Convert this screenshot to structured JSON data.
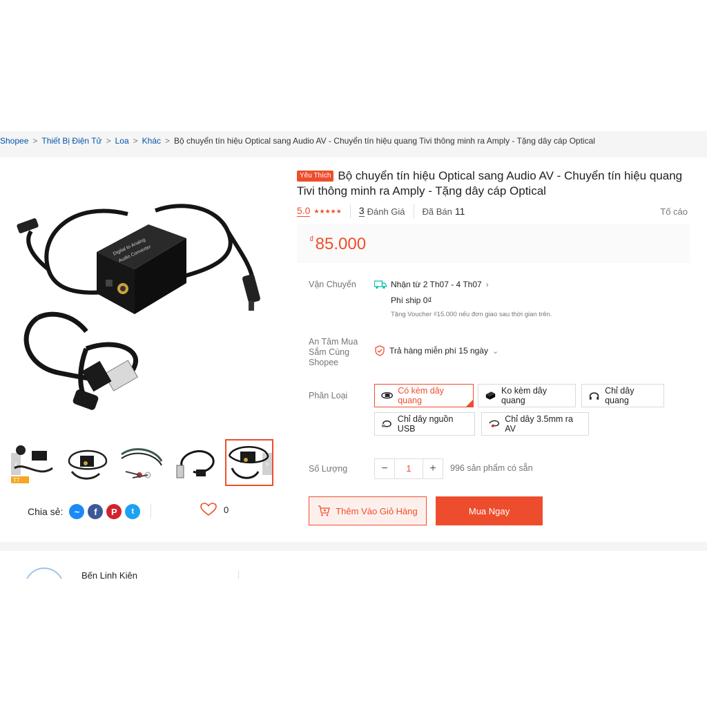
{
  "breadcrumb": {
    "items": [
      "Shopee",
      "Thiết Bị Điện Tử",
      "Loa",
      "Khác"
    ],
    "current": "Bộ chuyển tín hiệu Optical sang Audio AV - Chuyển tín hiệu quang Tivi thông minh ra Amply - Tặng dây cáp Optical"
  },
  "product": {
    "badge": "Yêu Thích",
    "title": "Bộ chuyển tín hiệu Optical sang Audio AV - Chuyển tín hiệu quang Tivi thông minh ra Amply - Tặng dây cáp Optical",
    "rating": "5.0",
    "stars": 5,
    "review_count": "3",
    "review_label": "Đánh Giá",
    "sold_label": "Đã Bán",
    "sold_count": "11",
    "report_label": "Tố cáo",
    "currency": "₫",
    "price": "85.000"
  },
  "shipping": {
    "label": "Vận Chuyển",
    "delivery": "Nhận từ 2 Th07 - 4 Th07",
    "fee": "Phí ship 0₫",
    "voucher_note": "Tặng Voucher ₫15.000 nếu đơn giao sau thời gian trên."
  },
  "guarantee": {
    "label": "An Tâm Mua Sắm Cùng Shopee",
    "text": "Trả hàng miễn phí 15 ngày"
  },
  "variants": {
    "label": "Phân Loại",
    "options": [
      "Có kèm dây quang",
      "Ko kèm dây quang",
      "Chỉ dây quang",
      "Chỉ dây nguồn USB",
      "Chỉ dây 3.5mm ra AV"
    ],
    "selected": "Có kèm dây quang"
  },
  "quantity": {
    "label": "Số Lượng",
    "minus": "−",
    "value": "1",
    "plus": "+",
    "stock": "996 sản phẩm có sẵn"
  },
  "actions": {
    "add_to_cart": "Thêm Vào Giỏ Hàng",
    "buy_now": "Mua Ngay"
  },
  "share": {
    "label": "Chia sẻ:",
    "like_count": "0"
  },
  "thumb_badge": "T7",
  "shop": {
    "name": "Bến Linh Kiện"
  },
  "colors": {
    "accent": "#ee4d2d",
    "link": "#0055aa",
    "messenger": "#1b8af7",
    "facebook": "#3b5998",
    "pinterest": "#d3212e",
    "twitter": "#1da1f2"
  }
}
